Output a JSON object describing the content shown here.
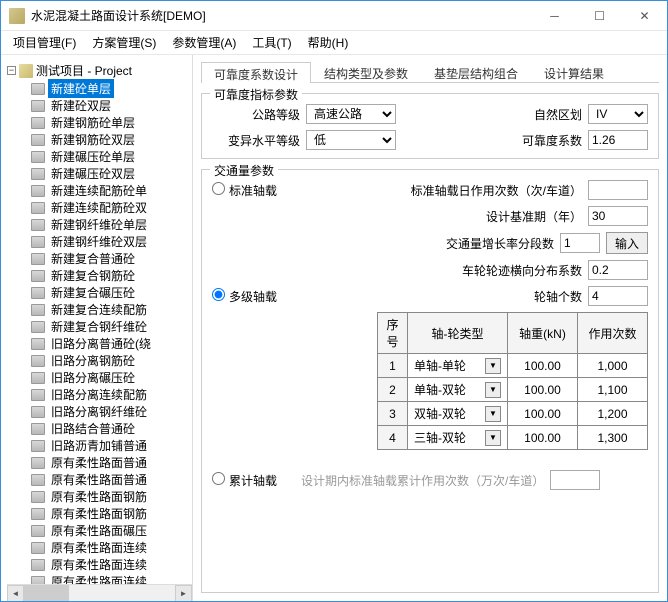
{
  "window": {
    "title": "水泥混凝土路面设计系统[DEMO]"
  },
  "menu": {
    "m1": "项目管理(F)",
    "m2": "方案管理(S)",
    "m3": "参数管理(A)",
    "m4": "工具(T)",
    "m5": "帮助(H)"
  },
  "tree": {
    "root": "测试项目 - Project",
    "items": [
      "新建砼单层",
      "新建砼双层",
      "新建钢筋砼单层",
      "新建钢筋砼双层",
      "新建碾压砼单层",
      "新建碾压砼双层",
      "新建连续配筋砼单",
      "新建连续配筋砼双",
      "新建钢纤维砼单层",
      "新建钢纤维砼双层",
      "新建复合普通砼",
      "新建复合钢筋砼",
      "新建复合碾压砼",
      "新建复合连续配筋",
      "新建复合钢纤维砼",
      "旧路分离普通砼(绕",
      "旧路分离钢筋砼",
      "旧路分离碾压砼",
      "旧路分离连续配筋",
      "旧路分离钢纤维砼",
      "旧路结合普通砼",
      "旧路沥青加铺普通",
      "原有柔性路面普通",
      "原有柔性路面普通",
      "原有柔性路面钢筋",
      "原有柔性路面钢筋",
      "原有柔性路面碾压",
      "原有柔性路面连续",
      "原有柔性路面连续",
      "原有柔性路面连续"
    ]
  },
  "tabs": {
    "t1": "可靠度系数设计",
    "t2": "结构类型及参数",
    "t3": "基垫层结构组合",
    "t4": "设计算结果"
  },
  "g1": {
    "title": "可靠度指标参数",
    "l1": "公路等级",
    "v1": "高速公路",
    "l2": "变异水平等级",
    "v2": "低",
    "l3": "自然区划",
    "v3": "IV",
    "l4": "可靠度系数",
    "v4": "1.26"
  },
  "g2": {
    "title": "交通量参数",
    "r1": "标准轴载",
    "r2": "多级轴载",
    "r3": "累计轴载",
    "l1": "标准轴载日作用次数（次/车道）",
    "l2": "设计基准期（年）",
    "v2": "30",
    "l3": "交通量增长率分段数",
    "v3": "1",
    "btn": "输入",
    "l4": "车轮轮迹横向分布系数",
    "v4": "0.2",
    "l5": "轮轴个数",
    "v5": "4",
    "l6": "设计期内标准轴载累计作用次数（万次/车道）",
    "th": {
      "c0": "序号",
      "c1": "轴-轮类型",
      "c2": "轴重(kN)",
      "c3": "作用次数"
    },
    "rows": [
      {
        "i": "1",
        "t": "单轴-单轮",
        "w": "100.00",
        "n": "1,000"
      },
      {
        "i": "2",
        "t": "单轴-双轮",
        "w": "100.00",
        "n": "1,100"
      },
      {
        "i": "3",
        "t": "双轴-双轮",
        "w": "100.00",
        "n": "1,200"
      },
      {
        "i": "4",
        "t": "三轴-双轮",
        "w": "100.00",
        "n": "1,300"
      }
    ]
  }
}
